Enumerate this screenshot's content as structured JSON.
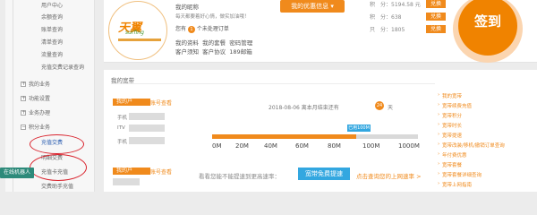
{
  "sidebar": {
    "items": [
      {
        "label": "用户中心",
        "type": "sub"
      },
      {
        "label": "余额查询",
        "type": "sub"
      },
      {
        "label": "账单查询",
        "type": "sub"
      },
      {
        "label": "清单查询",
        "type": "sub"
      },
      {
        "label": "流量查询",
        "type": "sub"
      },
      {
        "label": "充值交费记录查询",
        "type": "sub"
      },
      {
        "label": "我的业务",
        "type": "group"
      },
      {
        "label": "功能设置",
        "type": "group"
      },
      {
        "label": "业务办理",
        "type": "group"
      },
      {
        "label": "积分业务",
        "type": "group"
      },
      {
        "label": "充值交费",
        "type": "sub"
      },
      {
        "label": "明细交费",
        "type": "sub"
      },
      {
        "label": "充值卡充值",
        "type": "sub"
      },
      {
        "label": "交费助手充值",
        "type": "sub"
      }
    ],
    "online_agent": "在线机器人"
  },
  "top": {
    "logo_text": "天翼",
    "logo_sub": "surfing",
    "user_name": "我的昵称",
    "greeting": "每天都要着好心情，做实加油哦！",
    "pending_prefix": "您有",
    "pending_count": "1",
    "pending_suffix": "个未处理订单",
    "links_row1": [
      "我的资料",
      "我的套餐",
      "密码管理"
    ],
    "links_row2": [
      "客户须知",
      "客户协议",
      "189邮箱"
    ],
    "offer_button": "我的优惠信息 ▾",
    "points": [
      {
        "label": "积　分：",
        "value": "5194.58 元",
        "btn": "兑换"
      },
      {
        "label": "积　分：",
        "value": "638",
        "btn": "兑换"
      },
      {
        "label": "只　分：",
        "value": "1805",
        "btn": "兑换"
      }
    ],
    "signin_label": "签到"
  },
  "panel": {
    "title": "我的宽带",
    "accounts": [
      {
        "tag": "我的户",
        "tag2": "账号查看",
        "rows": [
          "手机",
          "ITV",
          "手机"
        ]
      },
      {
        "tag": "我的户",
        "tag2": "账号查看",
        "rows": []
      }
    ],
    "date_text": "2018-08-06  离本月结束还有",
    "days": "24",
    "days_unit": "天",
    "used_label": "已用100M",
    "used_value_m": 700,
    "total_m": 1000,
    "ticks": [
      "0M",
      "20M",
      "40M",
      "60M",
      "80M",
      "100M",
      "1000M"
    ],
    "speed_text": "看看您能不能提速到更高速率：",
    "speed_button": "宽带免费提速",
    "speed_link": "点击查询您的上网速率 >"
  },
  "right_links": [
    "我的宽带",
    "宽带续费充值",
    "宽带积分",
    "宽带时长",
    "宽带提速",
    "宽带改装/移机/撤销订单查询",
    "年付费优惠",
    "宽带套餐",
    "宽带套餐详细查询",
    "宽带上网指南"
  ]
}
